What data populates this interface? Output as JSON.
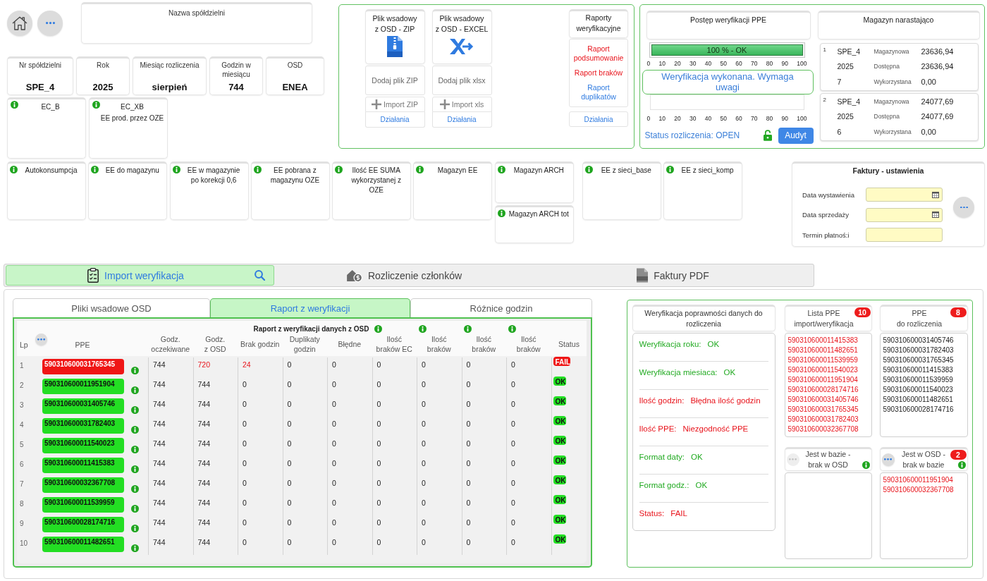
{
  "header": {
    "coop_name": {
      "label": "Nazwa spółdzielni"
    },
    "summary": [
      {
        "label": "Nr spółdzielni",
        "value": "SPE_4"
      },
      {
        "label": "Rok",
        "value": "2025"
      },
      {
        "label": "Miesiąc rozliczenia",
        "value": "sierpień"
      },
      {
        "label": "Godzin w\nmiesiącu",
        "value": "744"
      },
      {
        "label": "OSD",
        "value": "ENEA"
      }
    ],
    "ec_cards": [
      {
        "title": "EC_B"
      },
      {
        "title": "EC_XB",
        "subtitle": "EE prod. przez OZE"
      }
    ]
  },
  "uploads": {
    "files": [
      {
        "kind": "zip",
        "title": "Plik wsadowy\nz OSD - ZIP",
        "drop_label": "Dodaj plik ZIP",
        "import_button": "Import ZIP",
        "actions_link": "Działania"
      },
      {
        "kind": "excel",
        "title": "Plik wsadowy\nz OSD - EXCEL",
        "drop_label": "Dodaj plik xlsx",
        "import_button": "Import xls",
        "actions_link": "Działania"
      }
    ],
    "reports": {
      "title": "Raporty\nweryfikacyjne",
      "links": [
        {
          "label": "Raport podsumowanie",
          "color": "#e8141c"
        },
        {
          "label": "Raport braków",
          "color": "#e8141c"
        },
        {
          "label": "Raport duplikatów",
          "color": "#2f7be0"
        }
      ],
      "actions_link": "Działania"
    }
  },
  "progress": {
    "title": "Postęp weryfikacji PPE",
    "bars": [
      {
        "level": 1,
        "label": "100 % - OK",
        "ticks": [
          "0",
          "10",
          "20",
          "30",
          "40",
          "50",
          "60",
          "70",
          "80",
          "90",
          "100"
        ]
      },
      {
        "level": 0,
        "ticks": [
          "0",
          "10",
          "20",
          "30",
          "40",
          "50",
          "60",
          "70",
          "80",
          "90",
          "100"
        ]
      }
    ],
    "message": "Weryfikacja wykonana. Wymaga uwagi",
    "status": "Status rozliczenia: OPEN",
    "locked": false,
    "audit_button": "Audyt"
  },
  "storage": {
    "title": "Magazyn narastająco",
    "records": [
      {
        "index": "1",
        "cooperative": "SPE_4",
        "year": "2025",
        "month": "7",
        "amounts": [
          {
            "label": "Magazynowa",
            "value": "23636,94"
          },
          {
            "label": "Dostępna",
            "value": "23636,94"
          },
          {
            "label": "Wykorzystana",
            "value": "0,00"
          }
        ]
      },
      {
        "index": "2",
        "cooperative": "SPE_4",
        "year": "2025",
        "month": "6",
        "amounts": [
          {
            "label": "Magazynowa",
            "value": "24077,69"
          },
          {
            "label": "Dostępna",
            "value": "24077,69"
          },
          {
            "label": "Wykorzystana",
            "value": "0,00"
          }
        ]
      }
    ]
  },
  "energy_groups": [
    {
      "columns": [
        {
          "cards": [
            {
              "label": "Autokonsumpcja"
            }
          ]
        },
        {
          "cards": [
            {
              "label": "EE do magazynu"
            }
          ]
        },
        {
          "cards": [
            {
              "label": "EE w magazynie\npo korekcji 0,6"
            }
          ]
        },
        {
          "cards": [
            {
              "label": "EE pobrana z\nmagazynu OZE"
            }
          ]
        },
        {
          "cards": [
            {
              "label": "Ilość EE SUMA\nwykorzystanej z OZE"
            }
          ]
        },
        {
          "cards": [
            {
              "label": "Magazyn EE"
            }
          ]
        },
        {
          "cards": [
            {
              "label": "Magazyn ARCH"
            },
            {
              "label": "Magazyn ARCH tot"
            }
          ]
        }
      ]
    },
    {
      "columns": [
        {
          "cards": [
            {
              "label": "EE z sieci_base"
            }
          ]
        },
        {
          "cards": [
            {
              "label": "EE z sieci_komp"
            }
          ]
        }
      ]
    }
  ],
  "invoice_settings": {
    "title": "Faktury - ustawienia",
    "fields": [
      {
        "label": "Data wystawienia",
        "kind": "date"
      },
      {
        "label": "Data sprzedaży",
        "kind": "date"
      },
      {
        "label": "Termin płatnoś:i",
        "kind": "text"
      }
    ]
  },
  "main_tabs": [
    {
      "label": "Import weryfikacja",
      "kind": "import",
      "selected": true,
      "search": true
    },
    {
      "label": "Rozliczenie członków",
      "kind": "settlement",
      "selected": false,
      "search": false
    },
    {
      "label": "Faktury PDF",
      "kind": "pdf",
      "selected": false,
      "search": false
    }
  ],
  "sub_tabs": [
    {
      "label": "Pliki wsadowe OSD",
      "selected": false
    },
    {
      "label": "Raport z weryfikacji",
      "selected": true
    },
    {
      "label": "Różnice godzin",
      "selected": false
    }
  ],
  "report": {
    "title": "Raport z weryfikacji danych z OSD",
    "more_button": {
      "disabled": false
    },
    "columns": [
      {
        "label": "Lp",
        "kind": "index",
        "info": false
      },
      {
        "label": "PPE",
        "kind": "ppe",
        "info": false
      },
      {
        "label": "Godz.\noczekiwane",
        "kind": "number",
        "info": false
      },
      {
        "label": "Godz.\nz OSD",
        "kind": "number",
        "info": false
      },
      {
        "label": "Brak godzin",
        "kind": "number",
        "info": false
      },
      {
        "label": "Duplikaty\ngodzin",
        "kind": "number",
        "info": false
      },
      {
        "label": "Błędne",
        "kind": "number",
        "info": false
      },
      {
        "label": "Ilość\nbraków EC",
        "kind": "number",
        "info": true
      },
      {
        "label": "Ilość\nbraków",
        "kind": "number",
        "info": true
      },
      {
        "label": "Ilość\nbraków",
        "kind": "number",
        "info": true
      },
      {
        "label": "Ilość\nbraków",
        "kind": "number",
        "info": true
      },
      {
        "label": "Status",
        "kind": "status",
        "info": false
      }
    ],
    "rows": [
      {
        "ok": false,
        "cells": [
          {
            "value": "1"
          },
          {
            "value": "590310600031765345"
          },
          {
            "value": "744",
            "alert": false
          },
          {
            "value": "720",
            "alert": true
          },
          {
            "value": "24",
            "alert": true
          },
          {
            "value": "0",
            "alert": false
          },
          {
            "value": "0",
            "alert": false
          },
          {
            "value": "0",
            "alert": false
          },
          {
            "value": "0",
            "alert": false
          },
          {
            "value": "0",
            "alert": false
          },
          {
            "value": "0",
            "alert": false
          },
          {
            "value": "FAIL"
          }
        ]
      },
      {
        "ok": true,
        "cells": [
          {
            "value": "2"
          },
          {
            "value": "590310600011951904"
          },
          {
            "value": "744",
            "alert": false
          },
          {
            "value": "744",
            "alert": false
          },
          {
            "value": "0",
            "alert": false
          },
          {
            "value": "0",
            "alert": false
          },
          {
            "value": "0",
            "alert": false
          },
          {
            "value": "0",
            "alert": false
          },
          {
            "value": "0",
            "alert": false
          },
          {
            "value": "0",
            "alert": false
          },
          {
            "value": "0",
            "alert": false
          },
          {
            "value": "OK"
          }
        ]
      },
      {
        "ok": true,
        "cells": [
          {
            "value": "3"
          },
          {
            "value": "590310600031405746"
          },
          {
            "value": "744",
            "alert": false
          },
          {
            "value": "744",
            "alert": false
          },
          {
            "value": "0",
            "alert": false
          },
          {
            "value": "0",
            "alert": false
          },
          {
            "value": "0",
            "alert": false
          },
          {
            "value": "0",
            "alert": false
          },
          {
            "value": "0",
            "alert": false
          },
          {
            "value": "0",
            "alert": false
          },
          {
            "value": "0",
            "alert": false
          },
          {
            "value": "OK"
          }
        ]
      },
      {
        "ok": true,
        "cells": [
          {
            "value": "4"
          },
          {
            "value": "590310600031782403"
          },
          {
            "value": "744",
            "alert": false
          },
          {
            "value": "744",
            "alert": false
          },
          {
            "value": "0",
            "alert": false
          },
          {
            "value": "0",
            "alert": false
          },
          {
            "value": "0",
            "alert": false
          },
          {
            "value": "0",
            "alert": false
          },
          {
            "value": "0",
            "alert": false
          },
          {
            "value": "0",
            "alert": false
          },
          {
            "value": "0",
            "alert": false
          },
          {
            "value": "OK"
          }
        ]
      },
      {
        "ok": true,
        "cells": [
          {
            "value": "5"
          },
          {
            "value": "590310600011540023"
          },
          {
            "value": "744",
            "alert": false
          },
          {
            "value": "744",
            "alert": false
          },
          {
            "value": "0",
            "alert": false
          },
          {
            "value": "0",
            "alert": false
          },
          {
            "value": "0",
            "alert": false
          },
          {
            "value": "0",
            "alert": false
          },
          {
            "value": "0",
            "alert": false
          },
          {
            "value": "0",
            "alert": false
          },
          {
            "value": "0",
            "alert": false
          },
          {
            "value": "OK"
          }
        ]
      },
      {
        "ok": true,
        "cells": [
          {
            "value": "6"
          },
          {
            "value": "590310600011415383"
          },
          {
            "value": "744",
            "alert": false
          },
          {
            "value": "744",
            "alert": false
          },
          {
            "value": "0",
            "alert": false
          },
          {
            "value": "0",
            "alert": false
          },
          {
            "value": "0",
            "alert": false
          },
          {
            "value": "0",
            "alert": false
          },
          {
            "value": "0",
            "alert": false
          },
          {
            "value": "0",
            "alert": false
          },
          {
            "value": "0",
            "alert": false
          },
          {
            "value": "OK"
          }
        ]
      },
      {
        "ok": true,
        "cells": [
          {
            "value": "7"
          },
          {
            "value": "590310600032367708"
          },
          {
            "value": "744",
            "alert": false
          },
          {
            "value": "744",
            "alert": false
          },
          {
            "value": "0",
            "alert": false
          },
          {
            "value": "0",
            "alert": false
          },
          {
            "value": "0",
            "alert": false
          },
          {
            "value": "0",
            "alert": false
          },
          {
            "value": "0",
            "alert": false
          },
          {
            "value": "0",
            "alert": false
          },
          {
            "value": "0",
            "alert": false
          },
          {
            "value": "OK"
          }
        ]
      },
      {
        "ok": true,
        "cells": [
          {
            "value": "8"
          },
          {
            "value": "590310600011539959"
          },
          {
            "value": "744",
            "alert": false
          },
          {
            "value": "744",
            "alert": false
          },
          {
            "value": "0",
            "alert": false
          },
          {
            "value": "0",
            "alert": false
          },
          {
            "value": "0",
            "alert": false
          },
          {
            "value": "0",
            "alert": false
          },
          {
            "value": "0",
            "alert": false
          },
          {
            "value": "0",
            "alert": false
          },
          {
            "value": "0",
            "alert": false
          },
          {
            "value": "OK"
          }
        ]
      },
      {
        "ok": true,
        "cells": [
          {
            "value": "9"
          },
          {
            "value": "590310600028174716"
          },
          {
            "value": "744",
            "alert": false
          },
          {
            "value": "744",
            "alert": false
          },
          {
            "value": "0",
            "alert": false
          },
          {
            "value": "0",
            "alert": false
          },
          {
            "value": "0",
            "alert": false
          },
          {
            "value": "0",
            "alert": false
          },
          {
            "value": "0",
            "alert": false
          },
          {
            "value": "0",
            "alert": false
          },
          {
            "value": "0",
            "alert": false
          },
          {
            "value": "OK"
          }
        ]
      },
      {
        "ok": true,
        "cells": [
          {
            "value": "10"
          },
          {
            "value": "590310600011482651"
          },
          {
            "value": "744",
            "alert": false
          },
          {
            "value": "744",
            "alert": false
          },
          {
            "value": "0",
            "alert": false
          },
          {
            "value": "0",
            "alert": false
          },
          {
            "value": "0",
            "alert": false
          },
          {
            "value": "0",
            "alert": false
          },
          {
            "value": "0",
            "alert": false
          },
          {
            "value": "0",
            "alert": false
          },
          {
            "value": "0",
            "alert": false
          },
          {
            "value": "OK"
          }
        ]
      }
    ]
  },
  "verification": {
    "title": "Weryfikacja poprawności danych do rozliczenia",
    "checks": [
      {
        "label": "Weryfikacja roku:",
        "result": "OK",
        "ok": true
      },
      {
        "label": "Weryfikacja miesiaca:",
        "result": "OK",
        "ok": true
      },
      {
        "label": "Ilość godzin:",
        "result": "Błędna ilość godzin",
        "ok": false
      },
      {
        "label": "Ilość PPE:",
        "result": "Niezgodność PPE",
        "ok": false
      },
      {
        "label": "Format daty:",
        "result": "OK",
        "ok": true
      },
      {
        "label": "Format godz.:",
        "result": "OK",
        "ok": true
      },
      {
        "label": "Status:",
        "result": "FAIL",
        "ok": false
      }
    ]
  },
  "ppe_lists": [
    {
      "title": "Lista PPE\nimport/weryfikacja",
      "badge": "10",
      "info": false,
      "alert": true,
      "items": [
        "590310600011415383",
        "590310600011482651",
        "590310600011539959",
        "590310600011540023",
        "590310600011951904",
        "590310600028174716",
        "590310600031405746",
        "590310600031765345",
        "590310600031782403",
        "590310600032367708"
      ]
    },
    {
      "title": "PPE\ndo rozliczenia",
      "badge": "8",
      "info": false,
      "alert": false,
      "items": [
        "590310600031405746",
        "590310600031782403",
        "590310600031765345",
        "590310600011415383",
        "590310600011539959",
        "590310600011540023",
        "590310600011482651",
        "590310600028174716"
      ]
    },
    {
      "title": "Jest w bazie -\nbrak w OSD",
      "info": true,
      "more_button": {
        "disabled": true
      }
    },
    {
      "title": "Jest w OSD -\nbrak w bazie",
      "badge": "2",
      "info": true,
      "alert": true,
      "more_button": {
        "disabled": false
      },
      "items": [
        "590310600011951904",
        "590310600032367708"
      ]
    }
  ]
}
